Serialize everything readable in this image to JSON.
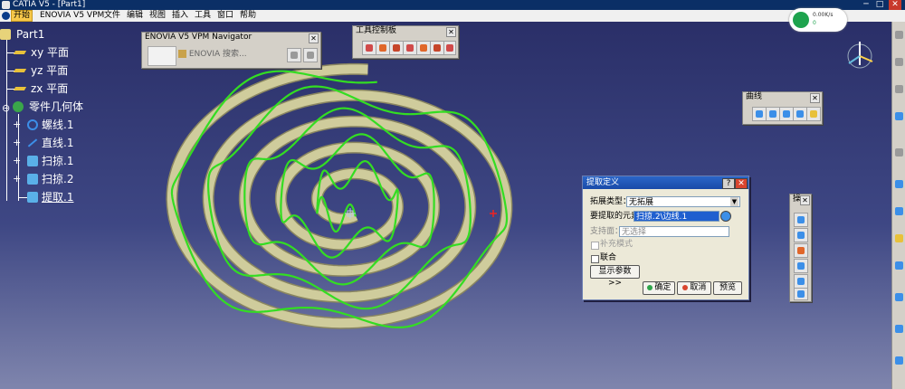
{
  "window": {
    "title": "CATIA V5 - [Part1]"
  },
  "menu": {
    "items": [
      "开始",
      "ENOVIA V5 VPM",
      "文件",
      "编辑",
      "视图",
      "插入",
      "工具",
      "窗口",
      "帮助"
    ],
    "active_index": 0
  },
  "tree": {
    "root": "Part1",
    "planes": [
      "xy 平面",
      "yz 平面",
      "zx 平面"
    ],
    "body": "零件几何体",
    "features": [
      "螺线.1",
      "直线.1",
      "扫掠.1",
      "扫掠.2",
      "提取.1"
    ]
  },
  "enovia_panel": {
    "title": "ENOVIA V5 VPM Navigator",
    "search_label": "ENOVIA 搜索..."
  },
  "tools_panel": {
    "title": "工具控制板"
  },
  "curve_panel": {
    "title": "曲线"
  },
  "ops_panel": {
    "title": "操"
  },
  "network": {
    "speed": "0.00K/s",
    "count": "0"
  },
  "dialog": {
    "title": "提取定义",
    "extension_type_label": "拓展类型：",
    "extension_type_value": "无拓展",
    "element_label": "要提取的元素",
    "element_value": "扫掠.2\\边线.1",
    "support_label": "支持面：",
    "support_value": "无选择",
    "complementary_label": "补充模式",
    "federation_label": "联合",
    "show_params_label": "显示参数 >>",
    "ok_label": "确定",
    "cancel_label": "取消",
    "preview_label": "预览"
  },
  "colors": {
    "viewport_top": "#2a2f68",
    "viewport_bottom": "#7f85ad",
    "surface": "#cfcc9c",
    "edge": "#33dd22"
  }
}
